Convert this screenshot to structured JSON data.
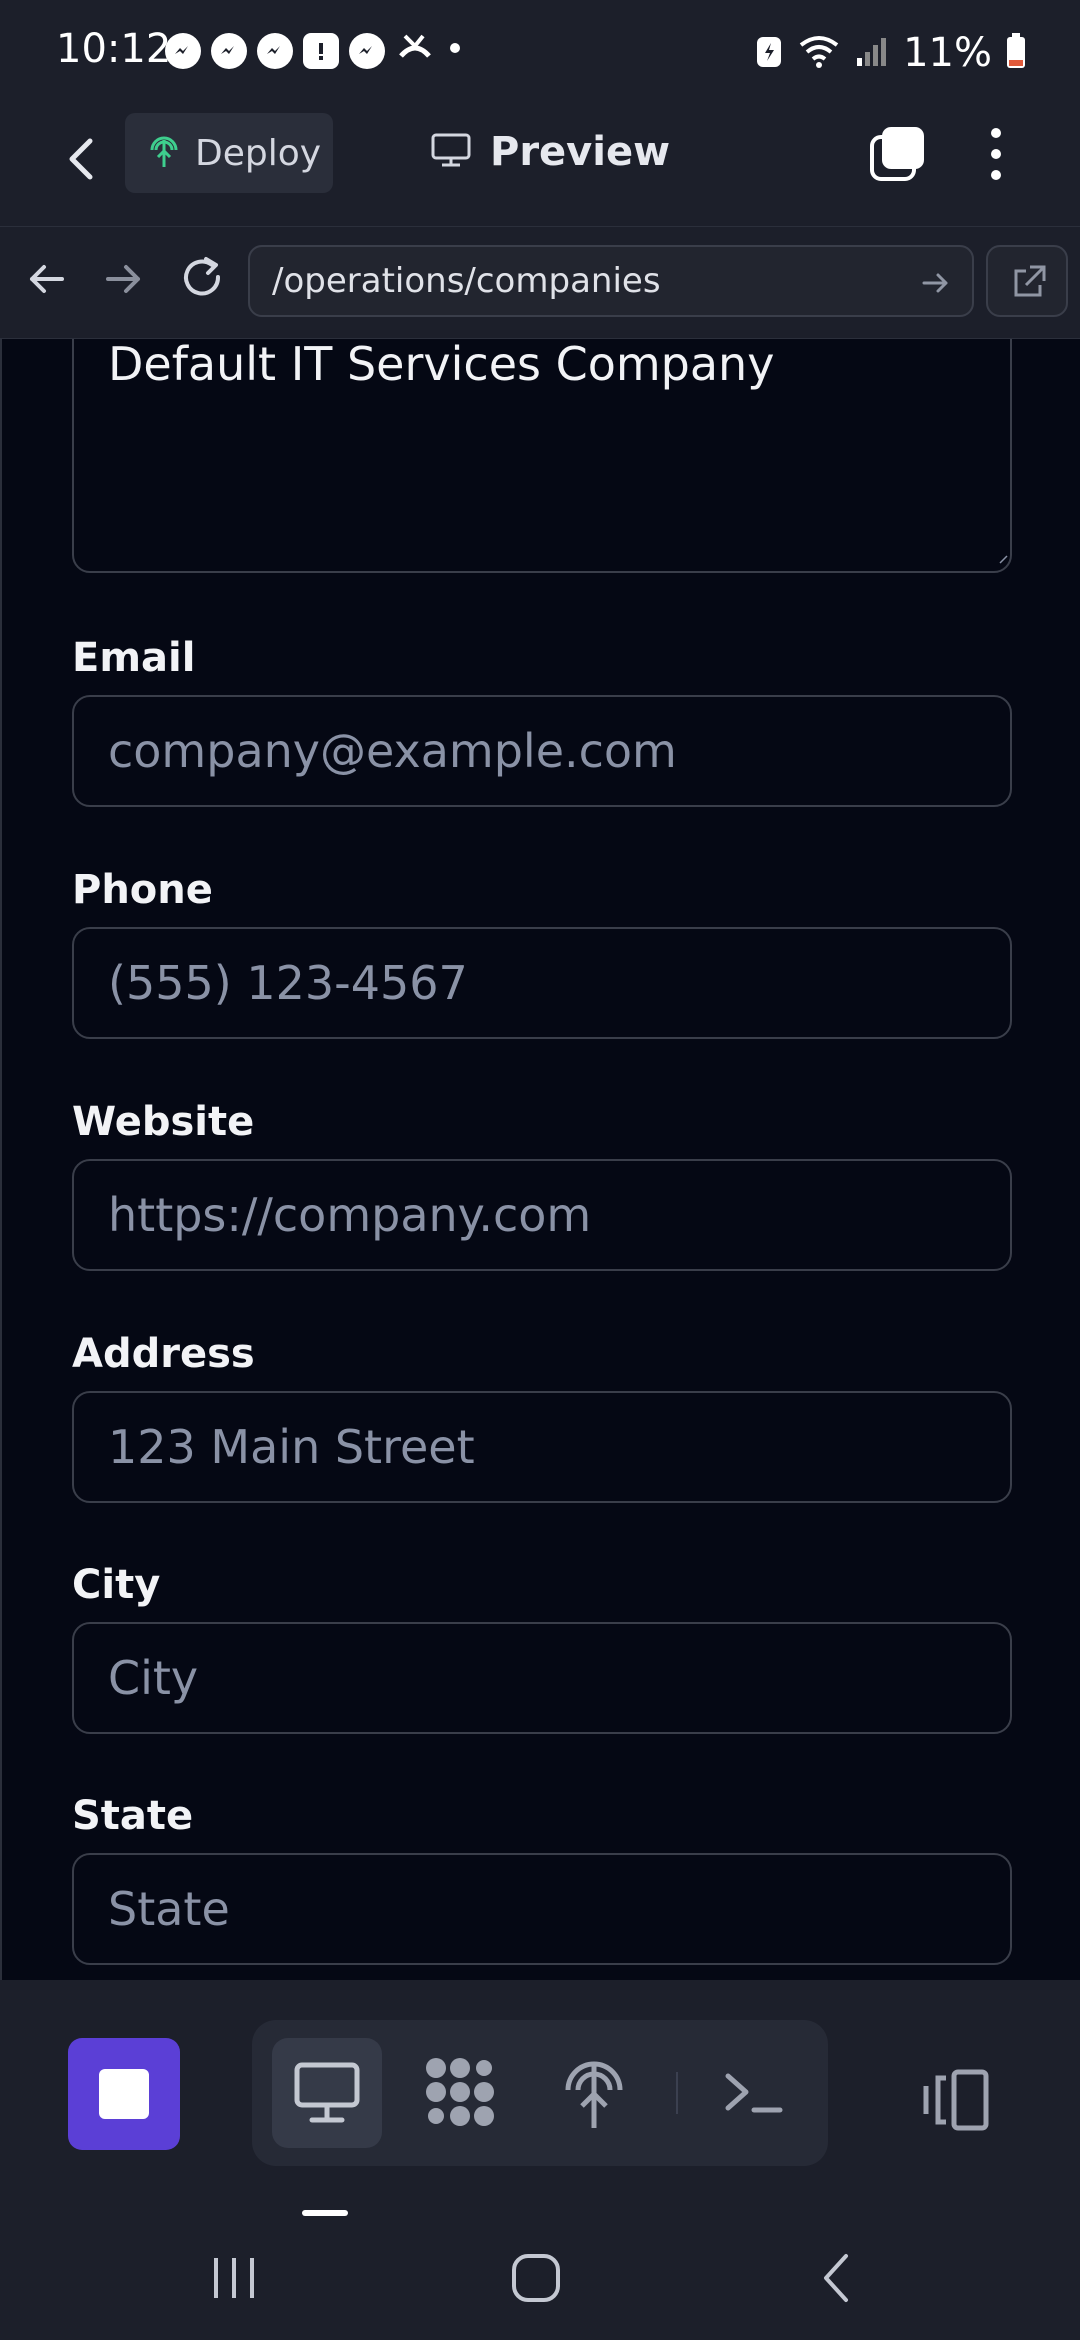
{
  "status": {
    "time": "10:12",
    "battery": "11%",
    "notification_icons": [
      "messenger-icon",
      "messenger-icon",
      "messenger-icon",
      "alert-icon",
      "messenger-icon",
      "missed-call-icon"
    ]
  },
  "toolbar": {
    "deploy_label": "Deploy",
    "preview_label": "Preview"
  },
  "browser": {
    "url": "/operations/companies"
  },
  "form": {
    "description_value": "Default IT Services Company",
    "fields": [
      {
        "label": "Email",
        "placeholder": "company@example.com"
      },
      {
        "label": "Phone",
        "placeholder": "(555) 123-4567"
      },
      {
        "label": "Website",
        "placeholder": "https://company.com"
      },
      {
        "label": "Address",
        "placeholder": "123 Main Street"
      },
      {
        "label": "City",
        "placeholder": "City"
      },
      {
        "label": "State",
        "placeholder": "State"
      }
    ]
  },
  "colors": {
    "accent": "#5b3fd6",
    "background": "#050814",
    "chrome": "#1c1f2a",
    "deploy_icon": "#3ecf8e"
  }
}
